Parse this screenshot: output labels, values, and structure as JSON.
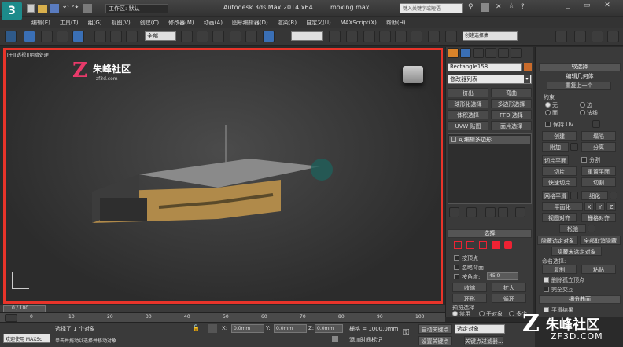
{
  "title_bar": {
    "workspace_label": "工作区: 默认",
    "app_title": "Autodesk 3ds Max  2014 x64",
    "file_name": "moxing.max",
    "search_placeholder": "键入关键字或短语"
  },
  "menu": [
    "编辑(E)",
    "工具(T)",
    "组(G)",
    "视图(V)",
    "创建(C)",
    "修改器(M)",
    "动画(A)",
    "图形编辑器(D)",
    "渲染(R)",
    "自定义(U)",
    "MAXScript(X)",
    "帮助(H)"
  ],
  "toolbar": {
    "selection_filter": "全部",
    "named_selection": "创建选择集"
  },
  "viewport": {
    "label": "[+][透视][明暗处理]",
    "logo_name": "朱峰社区",
    "logo_url": "zf3d.com",
    "border_color": "#e8342a"
  },
  "panel": {
    "object_name": "Rectangle158",
    "modifier_list": "修改器列表",
    "mod_buttons": [
      "挤出",
      "弯曲",
      "球形化选择",
      "多边形选择",
      "体积选择",
      "FFD 选择",
      "UVW 贴图",
      "面片选择"
    ],
    "stack_item": "可编辑多边形",
    "selection_rollout": {
      "title": "选择",
      "checks": [
        "按顶点",
        "忽略背面",
        "按角度:"
      ],
      "angle": "45.0",
      "btns": [
        "收缩",
        "扩大",
        "环形",
        "循环"
      ],
      "preview": "预览选择",
      "preview_opts": [
        "禁用",
        "子对象",
        "多个"
      ]
    }
  },
  "right_panel": {
    "soft_selection": "软选择",
    "edit_geometry": "编辑几何体",
    "repeat_last": "重复上一个",
    "constraints": "约束",
    "constraint_opts": [
      "无",
      "边",
      "面",
      "法线"
    ],
    "preserve_uv": "保持 UV",
    "create": "创建",
    "collapse": "塌陷",
    "attach": "附加",
    "detach": "分离",
    "slice_plane": "切片平面",
    "split": "分割",
    "slice": "切片",
    "reset_plane": "重置平面",
    "quickslice": "快速切片",
    "cut": "切割",
    "meshsmooth": "网格平滑",
    "tessellate": "细化",
    "make_planar": "平面化",
    "axes": [
      "X",
      "Y",
      "Z"
    ],
    "view_align": "视图对齐",
    "grid_align": "栅格对齐",
    "relax": "松弛",
    "hide_selected": "隐藏选定对象",
    "unhide_all": "全部取消隐藏",
    "hide_unselected": "隐藏未选定对象",
    "named_sel": "命名选择:",
    "copy": "复制",
    "paste": "粘贴",
    "delete_iso": "删除孤立顶点",
    "full_interact": "完全交互",
    "subdivision": "细分曲面",
    "smooth_result": "平滑结果"
  },
  "timeline": {
    "frame": "0 / 100",
    "ticks": [
      "0",
      "10",
      "20",
      "30",
      "40",
      "50",
      "60",
      "70",
      "80",
      "90",
      "100"
    ]
  },
  "status": {
    "maxscript": "欢迎使用 MAXSc",
    "selected": "选择了 1 个对象",
    "hint": "单击并拖动以选择并移动对象",
    "x": "0.0mm",
    "y": "0.0mm",
    "z": "0.0mm",
    "grid": "栅格 = 1000.0mm",
    "add_tag": "添加时间标记",
    "autokey": "自动关键点",
    "set_key": "设置关键点",
    "selected_obj": "选定对象",
    "key_filters": "关键点过滤器..."
  },
  "watermark": {
    "name": "朱峰社区",
    "url": "ZF3D.COM"
  }
}
